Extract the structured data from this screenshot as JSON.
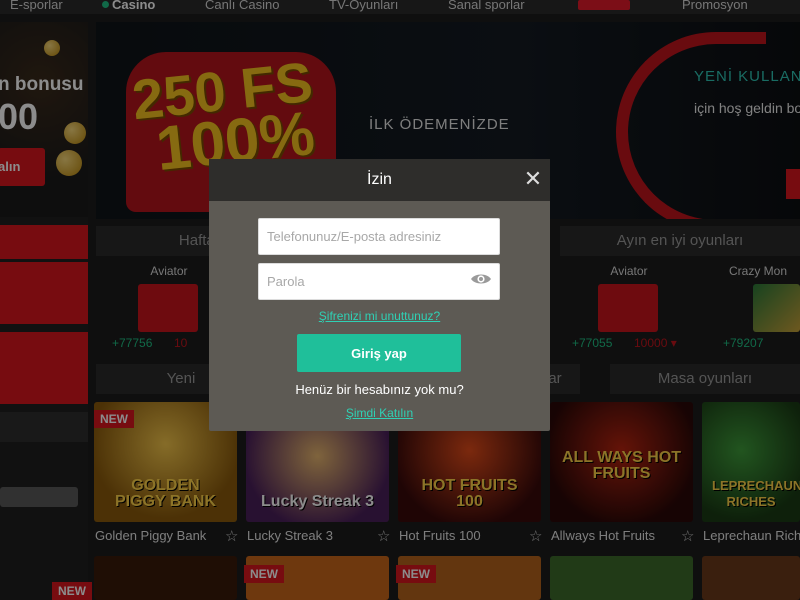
{
  "nav": {
    "items": [
      "E-sporlar",
      "Casino",
      "Canlı Casino",
      "TV-Oyunları",
      "Sanal sporlar",
      "Promosyon"
    ]
  },
  "sidebar": {
    "promo_title": "n bonusu",
    "promo_amount": "00",
    "promo_button": "alın"
  },
  "hero": {
    "fs": "250 FS",
    "percent": "100%",
    "subtitle": "İLK ÖDEMENİZDE",
    "new_user": "YENİ KULLANIC",
    "welcome": "için hoş geldin bo"
  },
  "sections": {
    "week": "Haftan",
    "month": "Ayın en iyi oyunları",
    "new_games": "Yeni",
    "mid_fragment": "ar",
    "table_games": "Masa oyunları"
  },
  "winners": [
    {
      "name": "Aviator",
      "amount": "+77756",
      "loss": "10"
    },
    {
      "name": "Aviator",
      "amount": "+77055",
      "loss": "10000 ▾"
    },
    {
      "name": "Crazy Mon",
      "amount": "+79207",
      "loss": ""
    }
  ],
  "tiles": [
    {
      "label": "GOLDEN PIGGY BANK",
      "caption": "Golden Piggy Bank",
      "new": "NEW"
    },
    {
      "label": "Lucky Streak 3",
      "caption": "Lucky Streak 3",
      "new": ""
    },
    {
      "label": "HOT FRUITS 100",
      "caption": "Hot Fruits 100",
      "new": ""
    },
    {
      "label": "ALL WAYS HOT FRUITS",
      "caption": "Allways Hot Fruits",
      "new": ""
    },
    {
      "label": "LEPRECHAUN RICHES",
      "caption": "Leprechaun Riche",
      "new": ""
    }
  ],
  "bottom_tags": {
    "new": "NEW"
  },
  "modal": {
    "title": "İzin",
    "close": "✕",
    "phone_placeholder": "Telefonunuz/E-posta adresiniz",
    "password_placeholder": "Parola",
    "forgot": "Şifrenizi mi unuttunuz?",
    "login": "Giriş yap",
    "no_account": "Henüz bir hesabınız yok mu?",
    "join": "Şimdi Katılın"
  },
  "colors": {
    "accent": "#1fbf9a",
    "link": "#2fd1b5",
    "brand_red": "#d9161e"
  }
}
